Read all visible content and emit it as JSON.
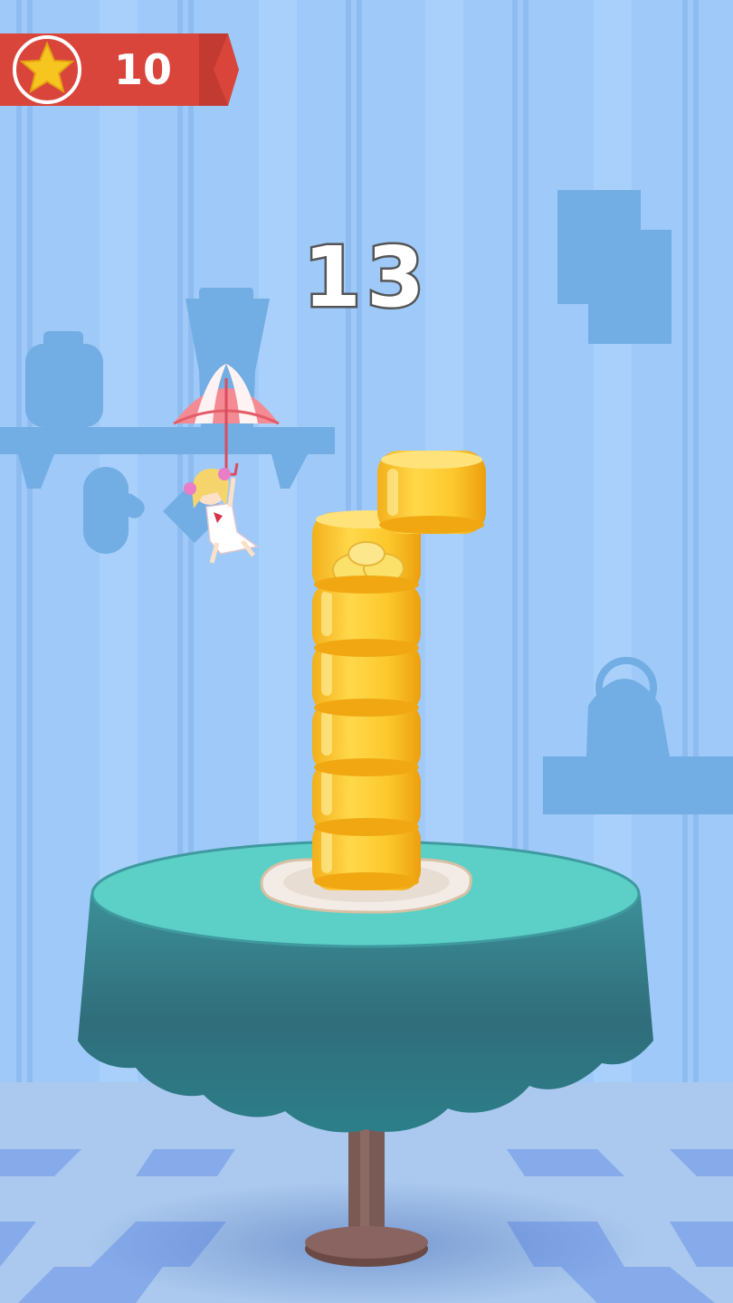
{
  "hud": {
    "star_icon": "star-icon",
    "stars": "10"
  },
  "score": "13",
  "colors": {
    "wall": "#9cc8f7",
    "wall_stripe": "#8dbbee",
    "silhouette": "#6fa9dd",
    "ribbon": "#d9453b",
    "star": "#f7c51f",
    "tablecloth": "#3e8d93",
    "tablecloth_top": "#5cd0c6",
    "jelly": "#f9c92a",
    "jelly_dark": "#e9a80e",
    "floor_light": "#aecbf0",
    "floor_dark": "#7fa6e8"
  },
  "tower": {
    "stacked_layers": 6,
    "moving_block": true
  }
}
